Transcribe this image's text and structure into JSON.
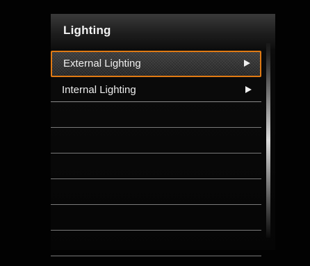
{
  "menu": {
    "title": "Lighting",
    "items": [
      {
        "label": "External Lighting",
        "selected": true,
        "has_submenu": true,
        "arrow_icon": "right-arrow-icon"
      },
      {
        "label": "Internal Lighting",
        "selected": false,
        "has_submenu": true,
        "arrow_icon": "right-arrow-icon"
      }
    ],
    "empty_row_count": 6
  },
  "colors": {
    "selection_border": "#e07a14",
    "text": "#eeeeee",
    "background": "#000000"
  }
}
